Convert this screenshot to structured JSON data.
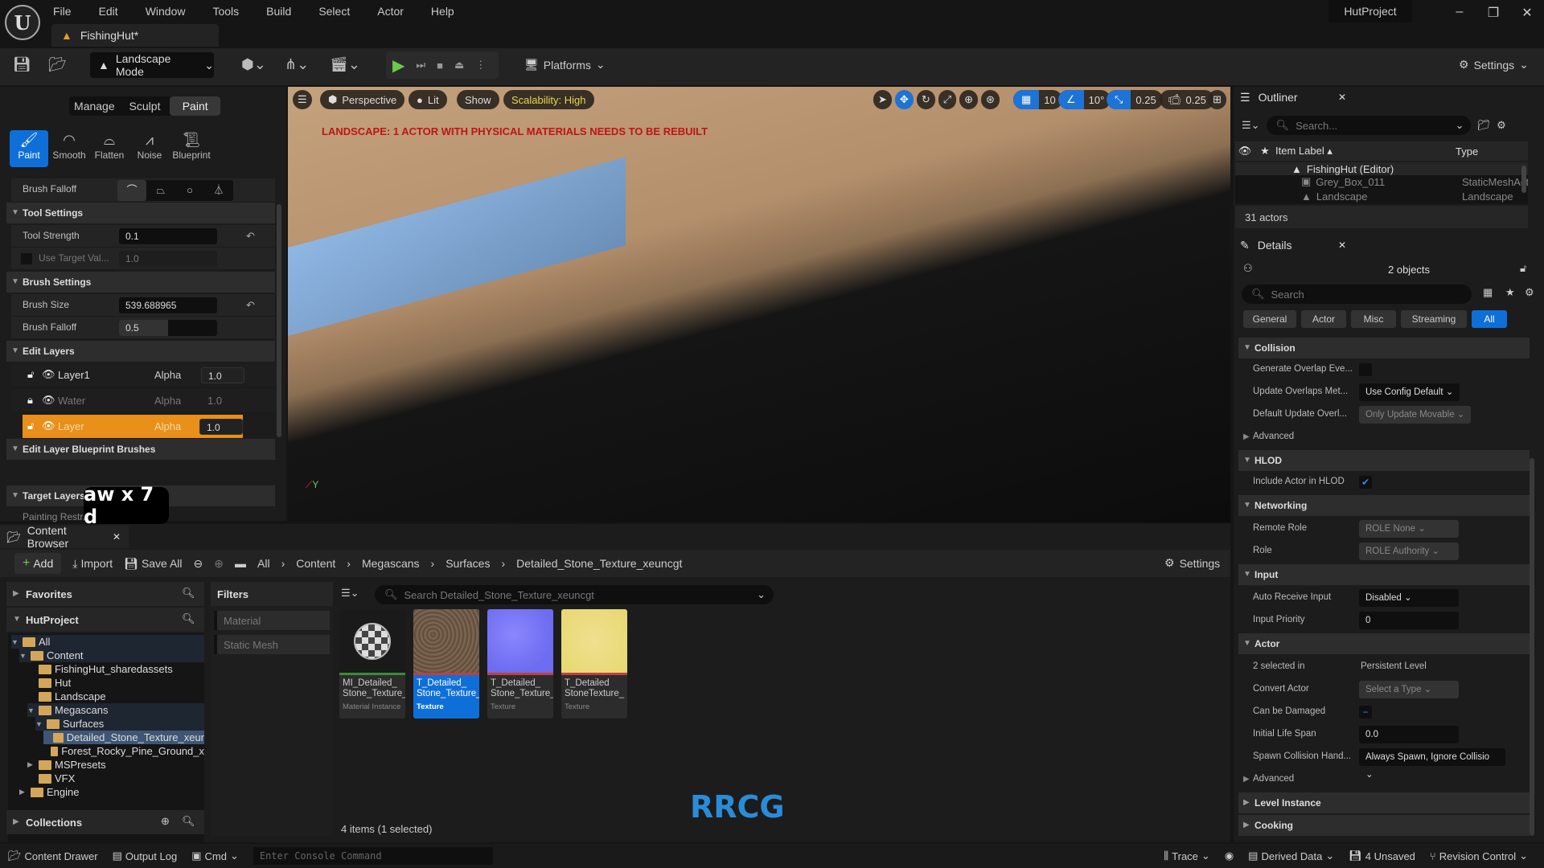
{
  "app": {
    "project_name": "HutProject",
    "document_tab": "FishingHut*",
    "menu": [
      "File",
      "Edit",
      "Window",
      "Tools",
      "Build",
      "Select",
      "Actor",
      "Help"
    ]
  },
  "toolbar": {
    "mode": "Landscape Mode",
    "platforms": "Platforms",
    "settings": "Settings"
  },
  "landscape": {
    "mode_tabs": [
      {
        "label": "Manage",
        "selected": false
      },
      {
        "label": "Sculpt",
        "selected": false
      },
      {
        "label": "Paint",
        "selected": true
      }
    ],
    "tools": [
      {
        "label": "Paint",
        "icon": "brush-icon",
        "selected": true
      },
      {
        "label": "Smooth",
        "icon": "smooth-icon",
        "selected": false
      },
      {
        "label": "Flatten",
        "icon": "flatten-icon",
        "selected": false
      },
      {
        "label": "Noise",
        "icon": "noise-icon",
        "selected": false
      },
      {
        "label": "Blueprint",
        "icon": "blueprint-icon",
        "selected": false
      }
    ],
    "brush_falloff_label": "Brush Falloff",
    "tool_settings": {
      "title": "Tool Settings",
      "tool_strength_label": "Tool Strength",
      "tool_strength": "0.1",
      "use_target_label": "Use Target Val...",
      "use_target_value": "1.0"
    },
    "brush_settings": {
      "title": "Brush Settings",
      "brush_size_label": "Brush Size",
      "brush_size": "539.688965",
      "brush_falloff_label": "Brush Falloff",
      "brush_falloff": "0.5"
    },
    "edit_layers": {
      "title": "Edit Layers",
      "layers": [
        {
          "name": "Layer1",
          "alpha_label": "Alpha",
          "alpha": "1.0",
          "locked": false,
          "selected": false
        },
        {
          "name": "Water",
          "alpha_label": "Alpha",
          "alpha": "1.0",
          "locked": true,
          "selected": false
        },
        {
          "name": "Layer",
          "alpha_label": "Alpha",
          "alpha": "1.0",
          "locked": false,
          "selected": true
        }
      ]
    },
    "bp_brushes_title": "Edit Layer Blueprint Brushes",
    "target_layers_title": "Target Layers",
    "painting_restriction_label": "Painting Restric..."
  },
  "keystroke_overlay": "aw x 7 d",
  "viewport": {
    "menu_icon": "hamburger-icon",
    "perspective": "Perspective",
    "lit": "Lit",
    "show": "Show",
    "scalability": "Scalability: High",
    "grid_snap": "10",
    "rot_snap": "10°",
    "scale_snap": "0.25",
    "camera_speed": "0.25",
    "warning": "LANDSCAPE: 1 ACTOR WITH PHYSICAL MATERIALS NEEDS TO BE REBUILT",
    "axis_label": "Y"
  },
  "outliner": {
    "title": "Outliner",
    "search_placeholder": "Search...",
    "col_label": "Item Label",
    "col_type": "Type",
    "rows": [
      {
        "label": "FishingHut (Editor)",
        "type": ""
      },
      {
        "label": "Grey_Box_011",
        "type": "StaticMeshAct"
      },
      {
        "label": "Landscape",
        "type": "Landscape"
      }
    ],
    "count": "31 actors"
  },
  "details": {
    "title": "Details",
    "objects": "2 objects",
    "search_placeholder": "Search",
    "filter_tabs": [
      {
        "label": "General",
        "selected": false
      },
      {
        "label": "Actor",
        "selected": false
      },
      {
        "label": "Misc",
        "selected": false
      },
      {
        "label": "Streaming",
        "selected": false
      },
      {
        "label": "All",
        "selected": true
      }
    ],
    "collision": {
      "title": "Collision",
      "gen_overlap": "Generate Overlap Eve...",
      "update_overlaps": "Update Overlaps Met...",
      "update_overlaps_value": "Use Config Default",
      "default_update": "Default Update Overl...",
      "default_update_value": "Only Update Movable",
      "advanced": "Advanced"
    },
    "hlod": {
      "title": "HLOD",
      "include": "Include Actor in HLOD"
    },
    "networking": {
      "title": "Networking",
      "remote_role": "Remote Role",
      "remote_role_value": "ROLE None",
      "role": "Role",
      "role_value": "ROLE Authority"
    },
    "input": {
      "title": "Input",
      "auto_receive": "Auto Receive Input",
      "auto_receive_value": "Disabled",
      "priority": "Input Priority",
      "priority_value": "0"
    },
    "actor": {
      "title": "Actor",
      "selected_in": "2 selected in",
      "selected_in_value": "Persistent Level",
      "convert": "Convert Actor",
      "convert_value": "Select a Type",
      "damaged": "Can be Damaged",
      "life_span": "Initial Life Span",
      "life_span_value": "0.0",
      "spawn": "Spawn Collision Hand...",
      "spawn_value": "Always Spawn, Ignore Collisio",
      "advanced": "Advanced"
    },
    "level_instance": "Level Instance",
    "cooking": "Cooking"
  },
  "content_browser": {
    "title": "Content Browser",
    "add": "Add",
    "import": "Import",
    "save_all": "Save All",
    "breadcrumb": [
      "All",
      "Content",
      "Megascans",
      "Surfaces",
      "Detailed_Stone_Texture_xeuncgt"
    ],
    "settings": "Settings",
    "favorites": "Favorites",
    "project": "HutProject",
    "collections": "Collections",
    "filters_title": "Filters",
    "filters": [
      "Material",
      "Static Mesh"
    ],
    "search_placeholder": "Search Detailed_Stone_Texture_xeuncgt",
    "tree": [
      {
        "label": "All",
        "depth": 0
      },
      {
        "label": "Content",
        "depth": 1
      },
      {
        "label": "FishingHut_sharedassets",
        "depth": 2
      },
      {
        "label": "Hut",
        "depth": 2
      },
      {
        "label": "Landscape",
        "depth": 2
      },
      {
        "label": "Megascans",
        "depth": 2
      },
      {
        "label": "Surfaces",
        "depth": 3
      },
      {
        "label": "Detailed_Stone_Texture_xeur",
        "depth": 4
      },
      {
        "label": "Forest_Rocky_Pine_Ground_x",
        "depth": 4
      },
      {
        "label": "MSPresets",
        "depth": 2
      },
      {
        "label": "VFX",
        "depth": 2
      },
      {
        "label": "Engine",
        "depth": 1
      }
    ],
    "assets": [
      {
        "name": "MI_Detailed_ Stone_Texture_",
        "type": "Material Instance",
        "color": "#3d8a3a",
        "selected": false
      },
      {
        "name": "T_Detailed_ Stone_Texture_",
        "type": "Texture",
        "color": "#c04040",
        "selected": true
      },
      {
        "name": "T_Detailed_ Stone_Texture_",
        "type": "Texture",
        "color": "#c04040",
        "selected": false
      },
      {
        "name": "T_Detailed StoneTexture_",
        "type": "Texture",
        "color": "#c04040",
        "selected": false
      }
    ],
    "status": "4 items (1 selected)"
  },
  "statusbar": {
    "content_drawer": "Content Drawer",
    "output_log": "Output Log",
    "cmd": "Cmd",
    "console_placeholder": "Enter Console Command",
    "trace": "Trace",
    "derived_data": "Derived Data",
    "unsaved": "4 Unsaved",
    "revision_control": "Revision Control"
  },
  "watermark": "RRCG"
}
